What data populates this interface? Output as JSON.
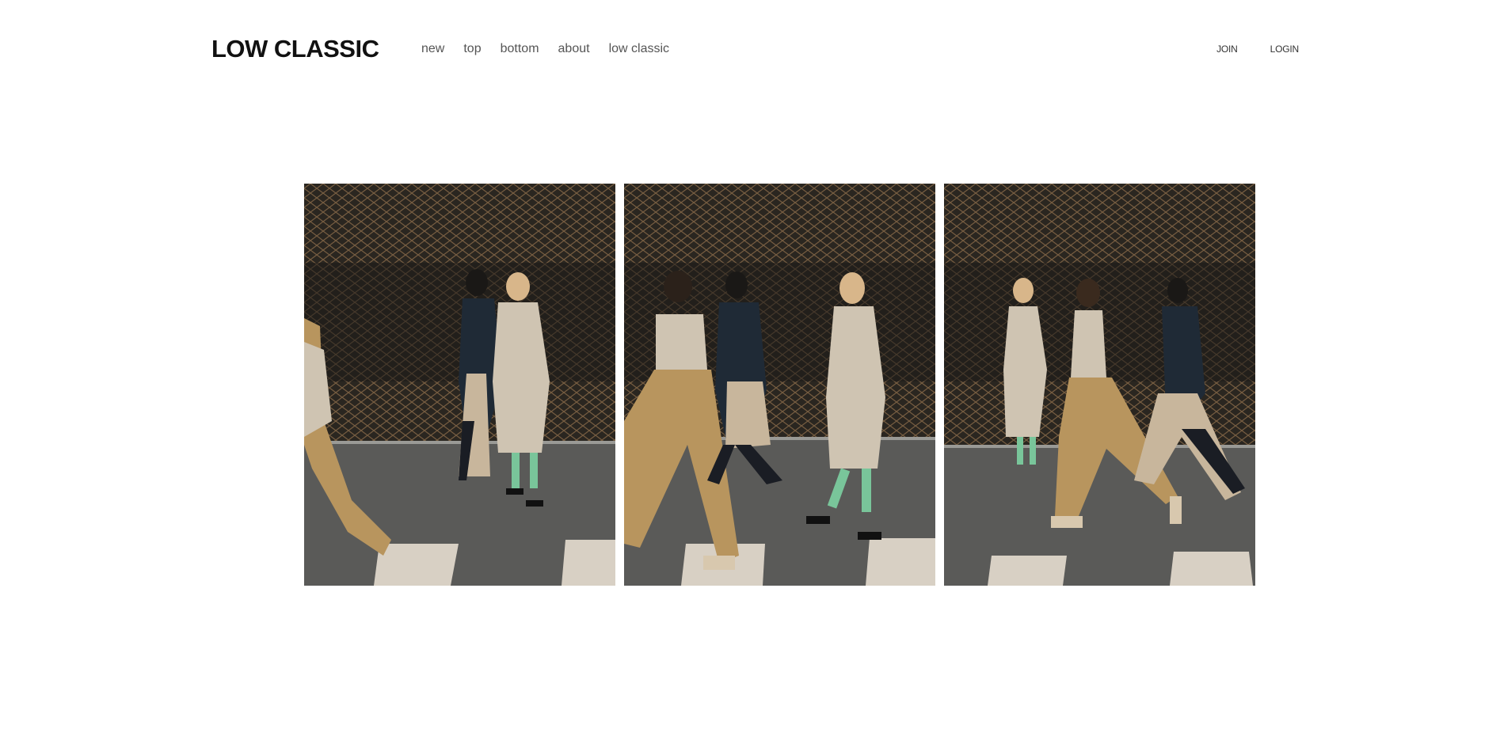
{
  "brand": {
    "logo_text": "LOW CLASSIC"
  },
  "nav": {
    "items": [
      {
        "label": "new"
      },
      {
        "label": "top"
      },
      {
        "label": "bottom"
      },
      {
        "label": "about"
      },
      {
        "label": "low classic"
      }
    ]
  },
  "member": {
    "join_label": "JOIN",
    "login_label": "LOGIN"
  },
  "gallery": {
    "images": [
      {
        "name": "lookbook-photo-1"
      },
      {
        "name": "lookbook-photo-2"
      },
      {
        "name": "lookbook-photo-3"
      }
    ]
  },
  "colors": {
    "background": "#ffffff",
    "text": "#111111",
    "nav_text": "#555555",
    "photo_bg": "#2a2620",
    "fence": "#8a6a4a",
    "street": "#5a5a58",
    "crosswalk": "#d8d0c4",
    "camel": "#b8955e",
    "beige": "#cfc4b2",
    "navy": "#1f2a36",
    "mint": "#79c59a"
  }
}
